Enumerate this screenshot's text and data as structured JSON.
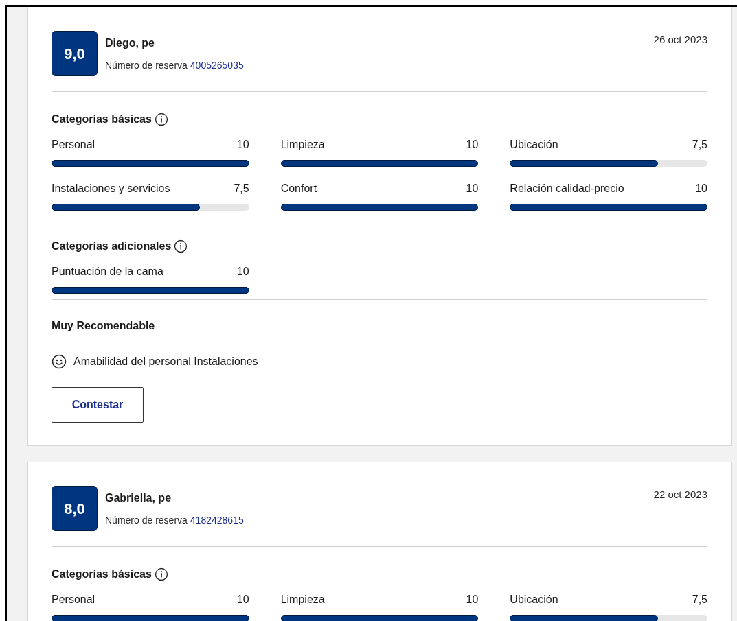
{
  "reviews": [
    {
      "score": "9,0",
      "name": "Diego, pe",
      "booking_label": "Número de reserva",
      "booking_number": "4005265035",
      "date": "26 oct 2023",
      "sections": [
        {
          "title": "Categorías básicas",
          "items": [
            {
              "label": "Personal",
              "value": "10",
              "level": 1
            },
            {
              "label": "Limpieza",
              "value": "10",
              "level": 1
            },
            {
              "label": "Ubicación",
              "value": "7,5",
              "level": 0.75
            },
            {
              "label": "Instalaciones y servicios",
              "value": "7,5",
              "level": 0.75
            },
            {
              "label": "Confort",
              "value": "10",
              "level": 1
            },
            {
              "label": "Relación calidad-precio",
              "value": "10",
              "level": 1
            }
          ]
        },
        {
          "title": "Categorías adicionales",
          "items": [
            {
              "label": "Puntuación de la cama",
              "value": "10",
              "level": 1
            }
          ]
        }
      ],
      "recommendation_title": "Muy Recomendable",
      "highlights": [
        "Amabilidad del personal Instalaciones"
      ],
      "reply_button": "Contestar"
    },
    {
      "score": "8,0",
      "name": "Gabriella, pe",
      "booking_label": "Número de reserva",
      "booking_number": "4182428615",
      "date": "22 oct 2023",
      "sections": [
        {
          "title": "Categorías básicas",
          "items": [
            {
              "label": "Personal",
              "value": "10",
              "level": 1
            },
            {
              "label": "Limpieza",
              "value": "10",
              "level": 1
            },
            {
              "label": "Ubicación",
              "value": "7,5",
              "level": 0.75
            }
          ]
        }
      ]
    }
  ]
}
